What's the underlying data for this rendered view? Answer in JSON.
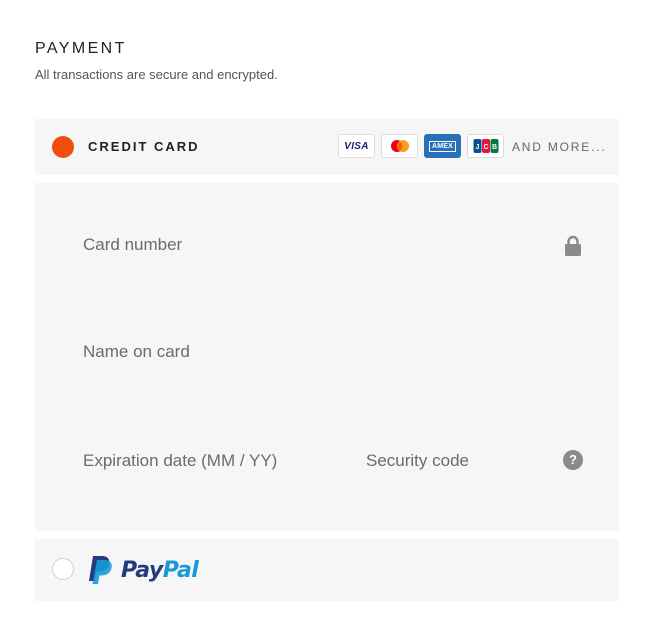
{
  "payment": {
    "title": "PAYMENT",
    "subtitle": "All transactions are secure and encrypted."
  },
  "credit_card": {
    "label": "CREDIT CARD",
    "selected": true,
    "accent_color": "#f04e0e",
    "brands": [
      {
        "name": "VISA",
        "icon": "visa-icon"
      },
      {
        "name": "Mastercard",
        "icon": "mastercard-icon"
      },
      {
        "name": "AMEX",
        "icon": "amex-icon"
      },
      {
        "name": "JCB",
        "icon": "jcb-icon"
      }
    ],
    "brand_text": {
      "visa": "VISA",
      "amex": "AMEX"
    },
    "and_more": "AND MORE...",
    "fields": {
      "card_number": "Card number",
      "name_on_card": "Name on card",
      "expiration": "Expiration date (MM / YY)",
      "security_code": "Security code"
    },
    "help_glyph": "?"
  },
  "paypal": {
    "selected": false,
    "logo_text_a": "Pay",
    "logo_text_b": "Pal",
    "colors": {
      "dark": "#253b80",
      "light": "#179bd7"
    }
  }
}
